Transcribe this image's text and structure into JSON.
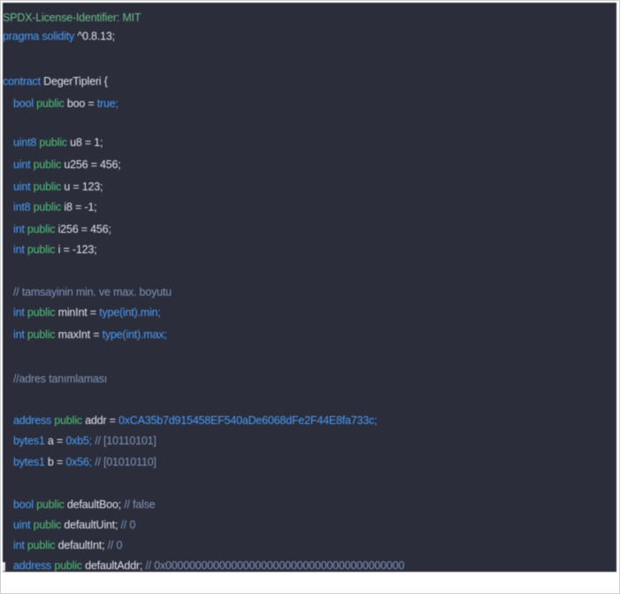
{
  "code": {
    "license": "SPDX-License-Identifier: MIT",
    "pragma_kw": "pragma solidity",
    "pragma_ver": "^0.8.13;",
    "contract_kw": "contract",
    "contract_name": "DegerTipleri {",
    "lines": [
      {
        "type": "bool",
        "mod": "public",
        "rest": "boo = ",
        "value": "true;"
      },
      {
        "type": "uint8",
        "mod": "public",
        "rest": "u8 = 1;"
      },
      {
        "type": "uint",
        "mod": "public",
        "rest": "u256 = 456;"
      },
      {
        "type": "uint",
        "mod": "public",
        "rest": "u = 123;"
      },
      {
        "type": "int8",
        "mod": "public",
        "rest": "i8 = -1;"
      },
      {
        "type": "int",
        "mod": "public",
        "rest": "i256 = 456;"
      },
      {
        "type": "int",
        "mod": "public",
        "rest": "i = -123;"
      },
      {
        "comment": "// tamsayinin min. ve max. boyutu"
      },
      {
        "type": "int",
        "mod": "public",
        "rest": "minInt = ",
        "value": "type(int).min;"
      },
      {
        "type": "int",
        "mod": "public",
        "rest": "maxInt = ",
        "value": "type(int).max;"
      },
      {
        "comment": "//adres tanımlaması"
      },
      {
        "type": "address",
        "mod": "public",
        "rest": "addr = ",
        "value": "0xCA35b7d915458EF540aDe6068dFe2F44E8fa733c;"
      },
      {
        "type": "bytes1",
        "rest": "a = ",
        "value": "0xb5;",
        "comment": "// [10110101]"
      },
      {
        "type": "bytes1",
        "rest": "b = ",
        "value": "0x56;",
        "comment": "// [01010110]"
      },
      {
        "type": "bool",
        "mod": "public",
        "rest": "defaultBoo;",
        "comment": "// false"
      },
      {
        "type": "uint",
        "mod": "public",
        "rest": "defaultUint;",
        "comment": "// 0"
      },
      {
        "type": "int",
        "mod": "public",
        "rest": "defaultInt;",
        "comment": "// 0"
      },
      {
        "type": "address",
        "mod": "public",
        "rest": "defaultAddr;",
        "comment": "// 0x0000000000000000000000000000000000000000"
      }
    ],
    "closing": "}"
  },
  "colors": {
    "background": "#2b2d3b",
    "keyword": "#4a9df8",
    "public": "#4ec27a",
    "text": "#e2e4ec",
    "comment": "#6bbc8a"
  }
}
